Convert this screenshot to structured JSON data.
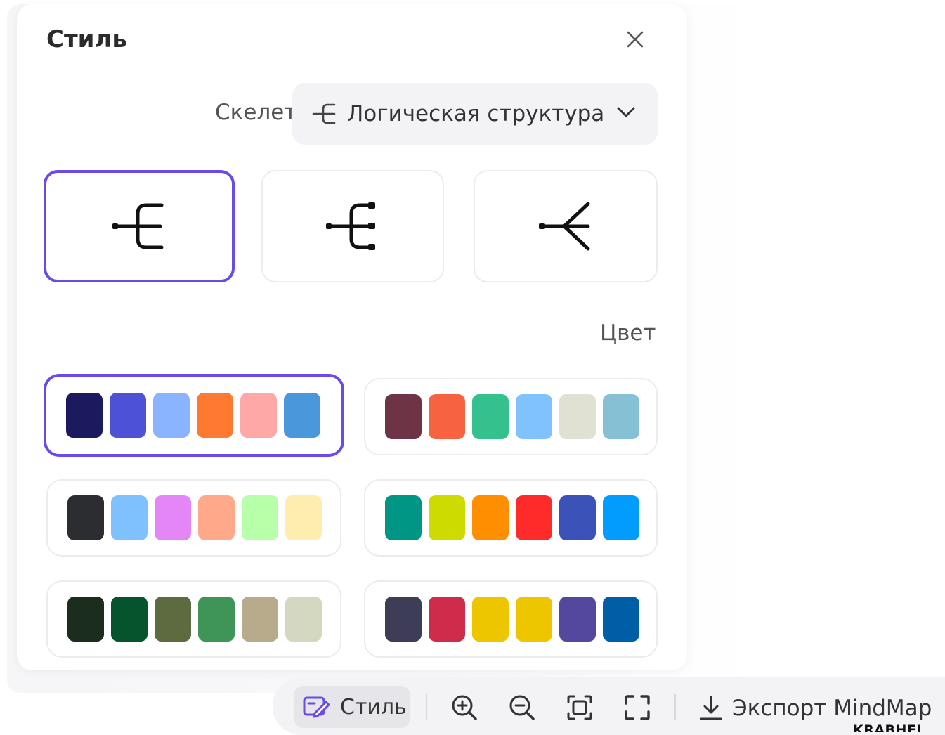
{
  "panel": {
    "title": "Стиль",
    "close_icon": "close-icon"
  },
  "skeleton": {
    "label": "Скелет",
    "selected_value": "Логическая структура",
    "icon": "logic-structure-icon"
  },
  "layout_options": [
    {
      "icon": "logic-structure-icon",
      "selected": true
    },
    {
      "icon": "logic-structure-dots-icon",
      "selected": false
    },
    {
      "icon": "fan-structure-icon",
      "selected": false
    }
  ],
  "color": {
    "label": "Цвет",
    "palettes": [
      {
        "selected": true,
        "colors": [
          "#1c1a5e",
          "#4c51d6",
          "#8ab4ff",
          "#ff7a30",
          "#ffa8a8",
          "#4a97db"
        ]
      },
      {
        "selected": false,
        "colors": [
          "#6e3344",
          "#f76341",
          "#35c18e",
          "#80c2fb",
          "#e0e0d3",
          "#86c0d4"
        ]
      },
      {
        "selected": false,
        "colors": [
          "#2b2d31",
          "#7fc0ff",
          "#e486f5",
          "#ffa88a",
          "#b8ffaa",
          "#ffedb0"
        ]
      },
      {
        "selected": false,
        "colors": [
          "#009685",
          "#cedb00",
          "#ff8f00",
          "#ff2a2a",
          "#3b52b8",
          "#009dff"
        ]
      },
      {
        "selected": false,
        "colors": [
          "#1b2e1e",
          "#05542e",
          "#5e6b40",
          "#3e9557",
          "#b7ab8c",
          "#d5d8c0"
        ]
      },
      {
        "selected": false,
        "colors": [
          "#3e3d57",
          "#cf2b4b",
          "#eec600",
          "#eec600",
          "#53479e",
          "#005ea6"
        ]
      }
    ]
  },
  "toolbar": {
    "style_label": "Стиль",
    "export_label": "Экспорт MindMap",
    "icons": [
      "style-edit-icon",
      "zoom-in-icon",
      "zoom-out-icon",
      "fit-screen-icon",
      "fullscreen-icon",
      "download-icon"
    ]
  },
  "watermark": "KRABHEL"
}
